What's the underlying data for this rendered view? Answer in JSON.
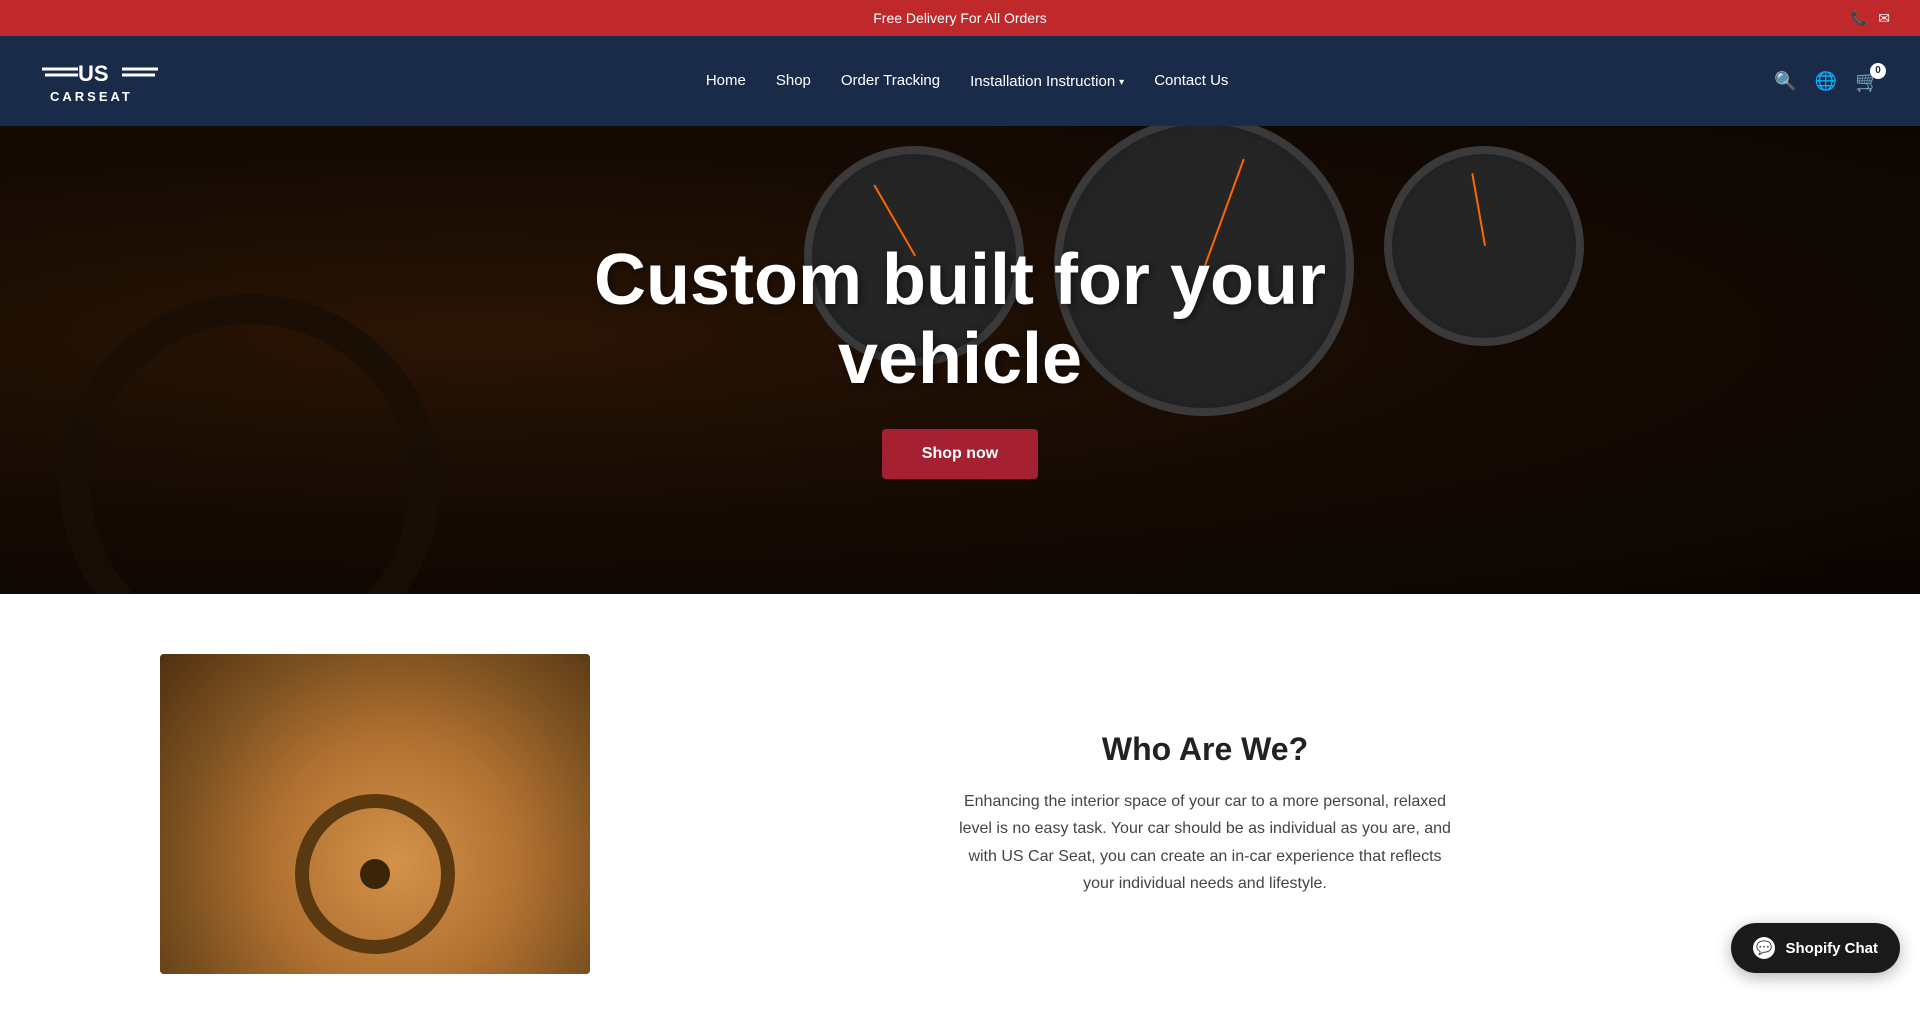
{
  "announcement": {
    "text": "Free Delivery For All Orders"
  },
  "nav": {
    "logo_line1": "≡US≡",
    "logo_line2": "CARSEAT",
    "links": [
      {
        "label": "Home",
        "href": "#",
        "has_dropdown": false
      },
      {
        "label": "Shop",
        "href": "#",
        "has_dropdown": false
      },
      {
        "label": "Order Tracking",
        "href": "#",
        "has_dropdown": false
      },
      {
        "label": "Installation Instruction",
        "href": "#",
        "has_dropdown": true
      },
      {
        "label": "Contact Us",
        "href": "#",
        "has_dropdown": false
      }
    ],
    "cart_count": "0"
  },
  "hero": {
    "title_line1": "Custom built for your",
    "title_line2": "vehicle",
    "cta_label": "Shop now"
  },
  "who_section": {
    "heading": "Who Are We?",
    "description": "Enhancing the interior space of your car to a more personal, relaxed level is no easy task. Your car should be as individual as you are, and with US Car Seat, you can create an in-car experience that reflects your individual needs and lifestyle."
  },
  "chat": {
    "label": "Shopify Chat",
    "short_label": "Chat"
  },
  "icons": {
    "search": "🔍",
    "globe": "🌐",
    "cart": "🛒",
    "phone": "📞",
    "email": "✉",
    "chat": "💬"
  },
  "colors": {
    "announcement_bg": "#c0292b",
    "header_bg": "#1a2b4a",
    "shop_btn_bg": "#a52030",
    "chat_btn_bg": "#1a1a1a"
  }
}
